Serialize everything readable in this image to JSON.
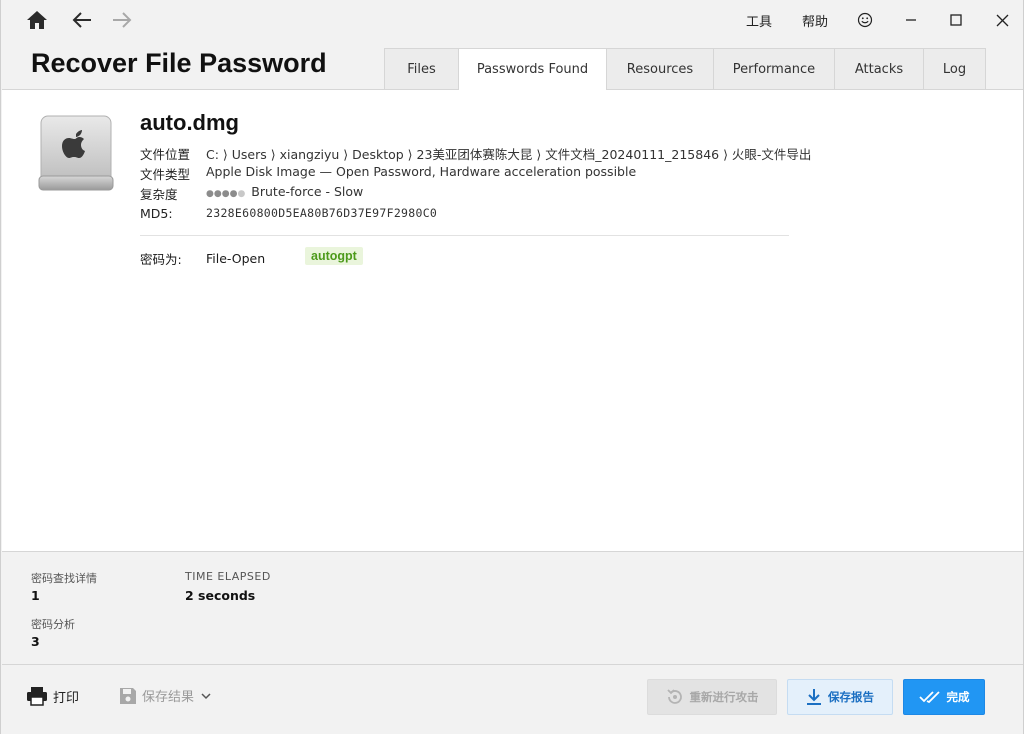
{
  "titlebar": {
    "tools_label": "工具",
    "help_label": "帮助"
  },
  "app": {
    "title": "Recover File Password"
  },
  "tabs": [
    {
      "label": "Files"
    },
    {
      "label": "Passwords Found"
    },
    {
      "label": "Resources"
    },
    {
      "label": "Performance"
    },
    {
      "label": "Attacks"
    },
    {
      "label": "Log"
    }
  ],
  "file": {
    "name": "auto.dmg",
    "location_label": "文件位置",
    "location_value": "C: ⟩ Users ⟩ xiangziyu ⟩ Desktop ⟩ 23美亚团体赛陈大昆 ⟩ 文件文档_20240111_215846 ⟩ 火眼-文件导出",
    "type_label": "文件类型",
    "type_value": "Apple Disk Image — Open Password, Hardware acceleration possible",
    "complexity_label": "复杂度",
    "complexity_value": "Brute-force - Slow",
    "complexity_level": 4,
    "complexity_max": 5,
    "md5_label": "MD5:",
    "md5_value": "2328E60800D5EA80B76D37E97F2980C0"
  },
  "password": {
    "label": "密码为:",
    "kind": "File-Open",
    "value": "autogpt"
  },
  "stats": {
    "found_label": "密码查找详情",
    "found_value": "1",
    "elapsed_label": "TIME ELAPSED",
    "elapsed_value": "2 seconds",
    "analysis_label": "密码分析",
    "analysis_value": "3"
  },
  "footer": {
    "print_label": "打印",
    "save_results_label": "保存结果",
    "rerun_label": "重新进行攻击",
    "save_report_label": "保存报告",
    "done_label": "完成"
  },
  "colors": {
    "accent": "#2196f3",
    "password_badge_bg": "#eaf5dc",
    "password_badge_text": "#4d9a1b"
  }
}
